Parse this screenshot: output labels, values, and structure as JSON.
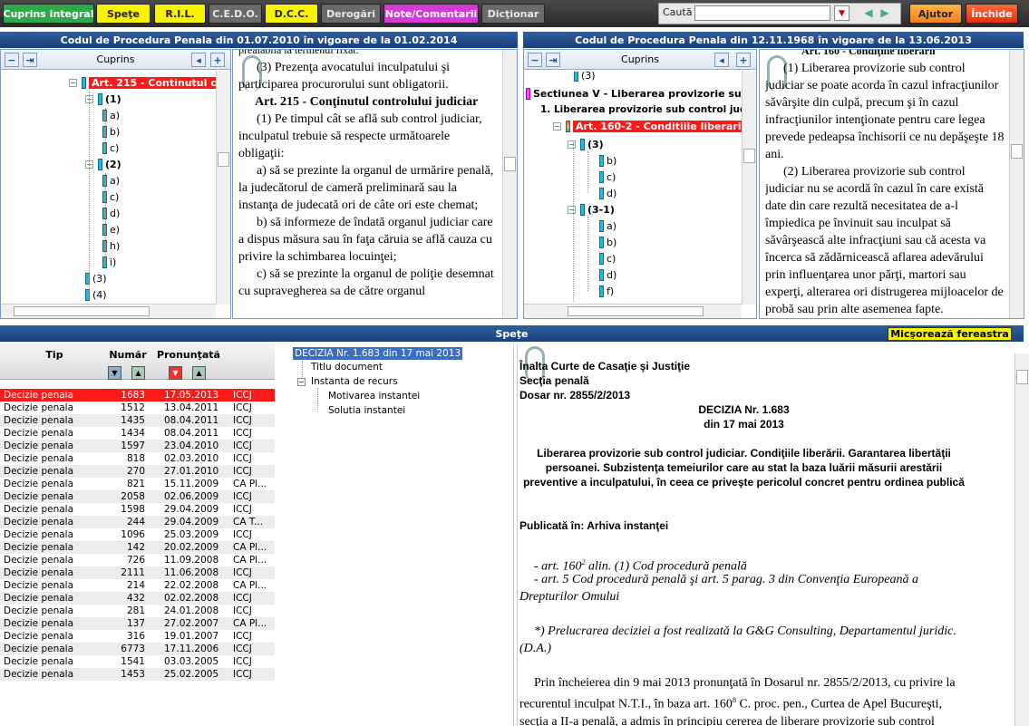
{
  "toolbar": {
    "buttons": [
      {
        "label": "Cuprins integral",
        "bg": "#2ea84a",
        "fg": "#ffffff"
      },
      {
        "label": "Speţe",
        "bg": "#f6f200",
        "fg": "#222222"
      },
      {
        "label": "R.I.L.",
        "bg": "#f6f200",
        "fg": "#222222"
      },
      {
        "label": "C.E.D.O.",
        "bg": "#6a6a6a",
        "fg": "#e8e8e8"
      },
      {
        "label": "D.C.C.",
        "bg": "#f6f200",
        "fg": "#222222"
      },
      {
        "label": "Derogări",
        "bg": "#6a6a6a",
        "fg": "#e8e8e8"
      },
      {
        "label": "Note/Comentarii",
        "bg": "#d63ad6",
        "fg": "#ffffff"
      },
      {
        "label": "Dicţionar",
        "bg": "#6a6a6a",
        "fg": "#e8e8e8"
      }
    ],
    "search_label": "Caută",
    "search_value": "",
    "help_label": "Ajutor",
    "close_label": "Închide"
  },
  "left_panel": {
    "title": "Codul de Procedura Penala din 01.07.2010 în vigoare de la 01.02.2014",
    "tree_header": "Cuprins",
    "tree": [
      {
        "label": "Art. 215 - Continutul con",
        "level": 0,
        "kind": "red",
        "expander": "-"
      },
      {
        "label": "(1)",
        "level": 1,
        "kind": "bold",
        "expander": "-"
      },
      {
        "label": "a)",
        "level": 2,
        "kind": "leaf"
      },
      {
        "label": "b)",
        "level": 2,
        "kind": "leaf"
      },
      {
        "label": "c)",
        "level": 2,
        "kind": "leaf"
      },
      {
        "label": "(2)",
        "level": 1,
        "kind": "bold",
        "expander": "-"
      },
      {
        "label": "a)",
        "level": 2,
        "kind": "leaf"
      },
      {
        "label": "c)",
        "level": 2,
        "kind": "leaf"
      },
      {
        "label": "d)",
        "level": 2,
        "kind": "leaf"
      },
      {
        "label": "e)",
        "level": 2,
        "kind": "leaf"
      },
      {
        "label": "h)",
        "level": 2,
        "kind": "leaf"
      },
      {
        "label": "i)",
        "level": 2,
        "kind": "leaf"
      },
      {
        "label": "(3)",
        "level": 1,
        "kind": "leafnum"
      },
      {
        "label": "(4)",
        "level": 1,
        "kind": "leafnum"
      }
    ],
    "doc_top_cut": "prealabila la termenul fixat.",
    "doc_para1": "(3) Prezenţa avocatului inculpatului şi participarea procurorului sunt obligatorii.",
    "doc_heading": "Art. 215 - Conţinutul controlului judiciar",
    "doc_para2": "(1) Pe timpul cât se află sub control judiciar, inculpatul trebuie să respecte următoarele obligaţii:",
    "doc_para3": "a) să se prezinte la organul de urmărire penală, la judecătorul de cameră preliminară sau la instanţa de judecată ori de câte ori este chemat;",
    "doc_para4": "b) să informeze de îndată organul judiciar care a dispus măsura sau în faţa căruia se află cauza cu privire la schimbarea locuinţei;",
    "doc_para5": "c) să se prezinte la organul de poliţie desemnat cu supravegherea sa de către organul"
  },
  "right_panel": {
    "title": "Codul de Procedura Penala din 12.11.1968 în vigoare de la 13.06.2013",
    "tree_header": "Cuprins",
    "tree": [
      {
        "label": "(3)",
        "kind": "leaf"
      },
      {
        "label": "Sectiunea V - Liberarea provizorie sub c",
        "kind": "section"
      },
      {
        "label": "1. Liberarea provizorie sub control judic",
        "kind": "bold"
      },
      {
        "label": "Art. 160-2 - Conditiile liberarii",
        "kind": "red"
      },
      {
        "label": "(3)",
        "kind": "boldnum"
      },
      {
        "label": "b)",
        "kind": "leaf"
      },
      {
        "label": "c)",
        "kind": "leaf"
      },
      {
        "label": "d)",
        "kind": "leaf"
      },
      {
        "label": "(3-1)",
        "kind": "boldnum"
      },
      {
        "label": "a)",
        "kind": "leaf"
      },
      {
        "label": "b)",
        "kind": "leaf"
      },
      {
        "label": "c)",
        "kind": "leaf"
      },
      {
        "label": "d)",
        "kind": "leaf"
      },
      {
        "label": "f)",
        "kind": "leaf"
      }
    ],
    "doc_top_cut": "Art. 160 - Condiţiile liberării",
    "doc_para1": "(1) Liberarea provizorie sub control judiciar se poate acorda în cazul infracţiunilor săvârşite din culpă, precum şi în cazul infracţiunilor intenţionate pentru care legea prevede pedeapsa închisorii ce nu depăşeşte 18 ani.",
    "doc_para2": "(2) Liberarea provizorie sub control judiciar nu se acordă în cazul în care există date din care rezultă necesitatea de a-l împiedica pe învinuit sau inculpat să săvârşească alte infracţiuni sau că acesta va încerca să zădărnicească aflarea adevărului prin influenţarea unor părţi, martori sau experţi, alterarea ori distrugerea mijloacelor de probă sau prin alte asemenea fapte."
  },
  "bottom": {
    "title": "Speţe",
    "minimize_label": "Micşorează fereastra",
    "columns": {
      "tip": "Tip",
      "numar": "Număr",
      "pronuntata": "Pronunţată"
    },
    "rows": [
      [
        "Decizie penala",
        "1683",
        "17.05.2013",
        "ICCJ"
      ],
      [
        "Decizie penala",
        "1512",
        "13.04.2011",
        "ICCJ"
      ],
      [
        "Decizie penala",
        "1435",
        "08.04.2011",
        "ICCJ"
      ],
      [
        "Decizie penala",
        "1434",
        "08.04.2011",
        "ICCJ"
      ],
      [
        "Decizie penala",
        "1597",
        "23.04.2010",
        "ICCJ"
      ],
      [
        "Decizie penala",
        "818",
        "02.03.2010",
        "ICCJ"
      ],
      [
        "Decizie penala",
        "270",
        "27.01.2010",
        "ICCJ"
      ],
      [
        "Decizie penala",
        "821",
        "15.11.2009",
        "CA Pl..."
      ],
      [
        "Decizie penala",
        "2058",
        "02.06.2009",
        "ICCJ"
      ],
      [
        "Decizie penala",
        "1598",
        "29.04.2009",
        "ICCJ"
      ],
      [
        "Decizie penala",
        "244",
        "29.04.2009",
        "CA T..."
      ],
      [
        "Decizie penala",
        "1096",
        "25.03.2009",
        "ICCJ"
      ],
      [
        "Decizie penala",
        "142",
        "20.02.2009",
        "CA Pl..."
      ],
      [
        "Decizie penala",
        "726",
        "11.09.2008",
        "CA Pl..."
      ],
      [
        "Decizie penala",
        "2111",
        "11.06.2008",
        "ICCJ"
      ],
      [
        "Decizie penala",
        "214",
        "22.02.2008",
        "CA Pl..."
      ],
      [
        "Decizie penala",
        "432",
        "02.02.2008",
        "ICCJ"
      ],
      [
        "Decizie penala",
        "281",
        "24.01.2008",
        "ICCJ"
      ],
      [
        "Decizie penala",
        "137",
        "27.02.2007",
        "CA Pl..."
      ],
      [
        "Decizie penala",
        "316",
        "19.01.2007",
        "ICCJ"
      ],
      [
        "Decizie penala",
        "6773",
        "17.11.2006",
        "ICCJ"
      ],
      [
        "Decizie penala",
        "1541",
        "03.03.2005",
        "ICCJ"
      ],
      [
        "Decizie penala",
        "1453",
        "25.02.2005",
        "ICCJ"
      ]
    ],
    "doc_tree": {
      "root": "DECIZIA Nr. 1.683 din 17 mai 2013",
      "titlu": "Titlu document",
      "instanta": "Instanta de recurs",
      "motivarea": "Motivarea instantei",
      "solutia": "Solutia instantei"
    },
    "decision": {
      "court": "Înalta Curte de Casaţie şi Justiţie",
      "section": "Secţia penală",
      "dosar": "Dosar nr. 2855/2/2013",
      "title1": "DECIZIA Nr. 1.683",
      "title2": "din 17 mai 2013",
      "summary": "Liberarea provizorie sub control judiciar. Condiţiile liberării. Garantarea libertăţii persoanei. Subzistenţa temeiurilor care au stat la baza luării măsurii arestării preventive a inculpatului, în ceea ce priveşte pericolul concret pentru ordinea publică",
      "published": "Publicată în: Arhiva instanţei",
      "ref1": "- art. 160",
      "ref1_sup": "2",
      "ref1_tail": " alin. (1) Cod procedură penală",
      "ref2": "- art. 5 Cod procedură penală şi art. 5 parag. 3 din Convenţia Europeană a Drepturilor Omului",
      "note": "*) Prelucrarea deciziei a fost realizată la G&G Consulting, Departamentul juridic. (D.A.)",
      "body_a": "Prin încheierea din 9 mai 2013 pronunţată în Dosarul nr. 2855/2/2013, cu privire la recurentul inculpat N.T.I., în baza art. 160",
      "body_sup": "8",
      "body_b": " C. proc. pen., Curtea de Apel Bucureşti, secţia a II-a penală, a admis în principiu cererea de liberare provizorie sub control"
    }
  }
}
